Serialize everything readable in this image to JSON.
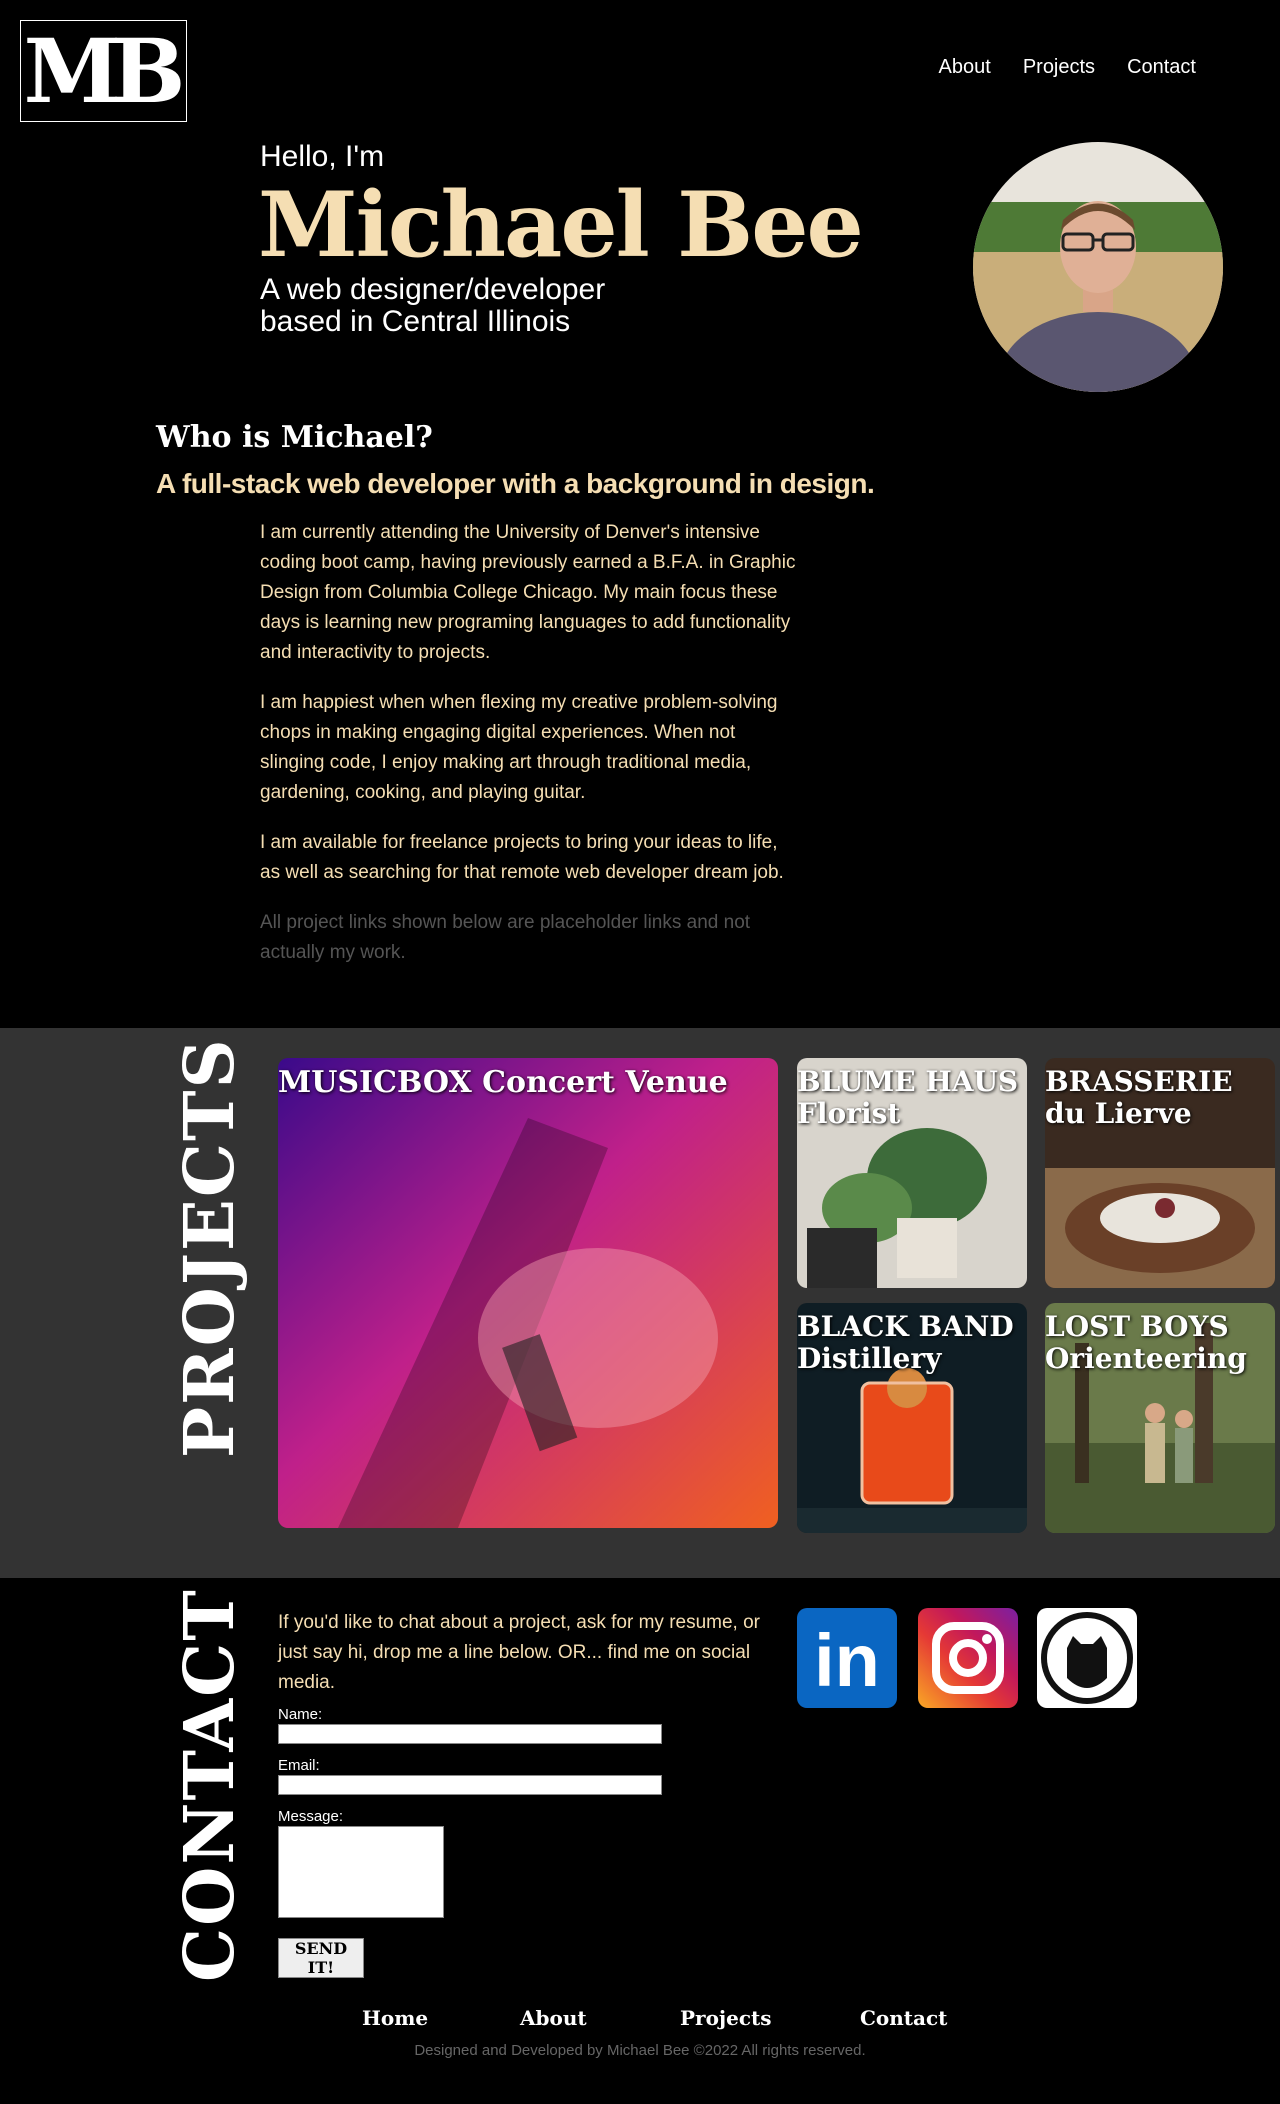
{
  "header": {
    "logo_text": "MB",
    "nav": [
      "About",
      "Projects",
      "Contact"
    ]
  },
  "hero": {
    "greeting": "Hello, I'm",
    "name": "Michael Bee",
    "tagline_1": "A web designer/developer",
    "tagline_2": "based in Central Illinois"
  },
  "about": {
    "heading": "Who is Michael?",
    "subheading": "A full-stack web developer with a background in design.",
    "paragraphs": [
      "I am currently attending the University of Denver's intensive coding boot camp, having previously earned a B.F.A. in Graphic Design from Columbia College Chicago. My main focus these days is learning new programing languages to add functionality and interactivity to projects.",
      "I am happiest when when flexing my creative problem-solving chops in making engaging digital experiences. When not slinging code, I enjoy making art through traditional media, gardening, cooking, and playing guitar.",
      "I am available for freelance projects to bring your ideas to life, as well as searching for that remote web developer dream job."
    ],
    "disclaimer": "All project links shown below are placeholder links and not actually my work."
  },
  "projects": {
    "title": "PROJECTS",
    "items": [
      {
        "label": "MUSICBOX Concert Venue"
      },
      {
        "label": "BLUME HAUS Florist"
      },
      {
        "label": "BRASSERIE du Lierve"
      },
      {
        "label": "BLACK BAND Distillery"
      },
      {
        "label": "LOST BOYS Orienteering"
      }
    ]
  },
  "contact": {
    "title": "CONTACT",
    "intro": "If you'd like to chat about a project, ask for my resume, or just say hi, drop me a line below. OR... find me on social media.",
    "name_label": "Name:",
    "email_label": "Email:",
    "message_label": "Message:",
    "send_label": "SEND IT!",
    "social_linkedin": "in"
  },
  "footer": {
    "nav": [
      "Home",
      "About",
      "Projects",
      "Contact"
    ],
    "copyright": "Designed and Developed by Michael Bee ©2022 All rights reserved."
  },
  "colors": {
    "accent": "#f5deb3",
    "background": "#000000",
    "projects_bg": "#333333",
    "linkedin": "#0a66c2"
  }
}
